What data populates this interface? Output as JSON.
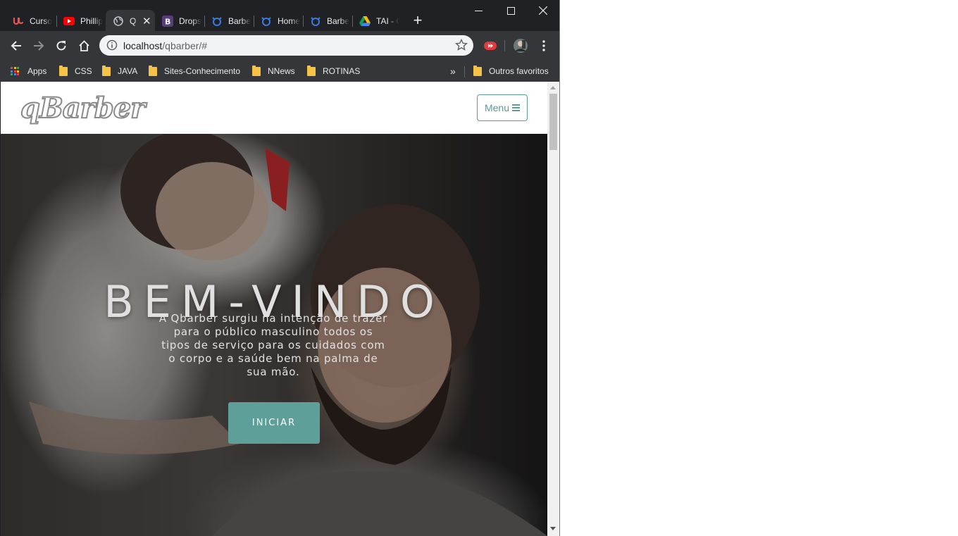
{
  "browser": {
    "tabs": [
      {
        "title": "Curso",
        "icon": "udemy-icon"
      },
      {
        "title": "Phillip",
        "icon": "youtube-icon"
      },
      {
        "title": "Q",
        "icon": "globe-icon",
        "active": true
      },
      {
        "title": "Drops",
        "icon": "bootstrap-icon"
      },
      {
        "title": "Barbe",
        "icon": "barber-icon"
      },
      {
        "title": "Home",
        "icon": "barber-icon"
      },
      {
        "title": "Barbe",
        "icon": "barber-icon"
      },
      {
        "title": "TAI - C",
        "icon": "google-drive-icon"
      }
    ],
    "close_tab_label": "✕",
    "new_tab_label": "+",
    "url_host": "localhost",
    "url_path": "/qbarber/#",
    "bookmarks": {
      "apps": "Apps",
      "items": [
        "CSS",
        "JAVA",
        "Sites-Conhecimento",
        "NNews",
        "ROTINAS"
      ],
      "overflow": "»",
      "other": "Outros favoritos"
    }
  },
  "site": {
    "logo": "qBarber",
    "menu_label": "Menu",
    "hero_title": "BEM-VINDO",
    "hero_text": "A Qbarber surgiu na intenção de trazer para o público masculino todos os tipos de serviço para os cuidados com o corpo e a saúde bem na palma de sua mão.",
    "cta_label": "INICIAR",
    "colors": {
      "accent": "#5f9f9a"
    }
  }
}
